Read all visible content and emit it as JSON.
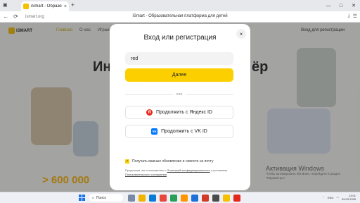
{
  "browser": {
    "tab_title": "iSmart - Образователь",
    "tab_close": "×",
    "new_tab": "+",
    "url": "ismart.org",
    "page_title": "iSmart - Образовательная платформа для детей",
    "win_min": "—",
    "win_max": "□",
    "win_close": "✕"
  },
  "site": {
    "logo": "iSMART",
    "nav": [
      "Главная",
      "О нас",
      "Играем"
    ],
    "login_link": "Вход для регистрации",
    "hero_left": "Ин",
    "hero_right": "ёр",
    "stat": "> 600 000"
  },
  "watermark": {
    "title": "Активация Windows",
    "text": "Чтобы активировать Windows, перейдите в раздел \"Параметры\"."
  },
  "modal": {
    "title": "Вход или регистрация",
    "close": "×",
    "input_value": "red",
    "next_label": "Далее",
    "or_label": "или",
    "yandex_label": "Продолжить с Яндекс ID",
    "yandex_glyph": "Я",
    "vk_label": "Продолжить с VK ID",
    "vk_glyph": "VK",
    "checkbox_label": "Получать важные обновление и новости на почту",
    "checkbox_mark": "✓",
    "legal_prefix": "Продолжая, вы соглашаетесь с ",
    "legal_link1": "Политикой конфиденциальности",
    "legal_mid": " и условиями ",
    "legal_link2": "Пользовательского соглашения"
  },
  "taskbar": {
    "search_label": "Поиск",
    "lang": "ENG",
    "time": "13:01",
    "date": "09.03.2025"
  },
  "colors": {
    "accent": "#fcd000",
    "yandex": "#e3271c",
    "vk": "#0077ff"
  }
}
